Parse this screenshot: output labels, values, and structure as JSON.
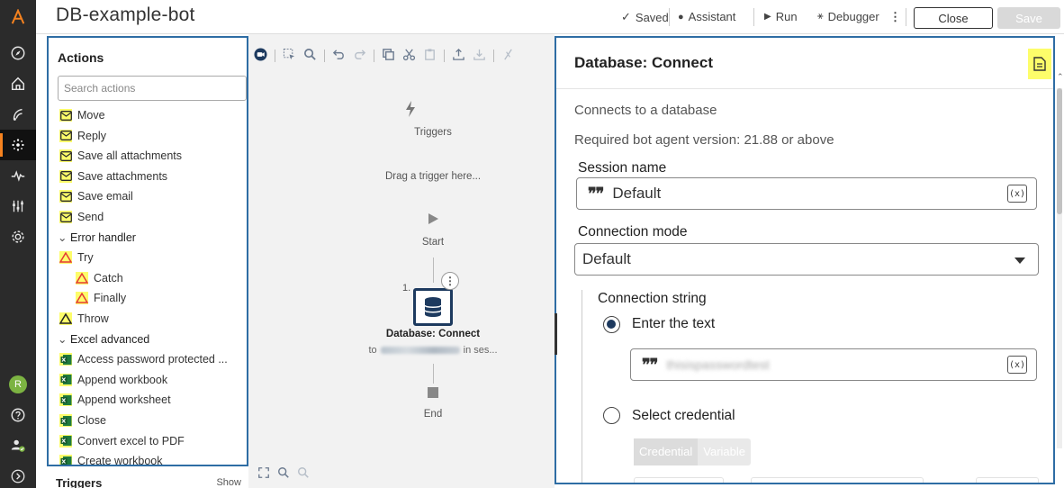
{
  "rail": {
    "icons": [
      "automation-logo-icon",
      "compass-icon",
      "home-icon",
      "bot-icon",
      "automations-icon",
      "pulse-icon",
      "sliders-icon",
      "settings-icon",
      "user-avatar",
      "help-icon",
      "user-check-icon",
      "chevron-right-icon"
    ],
    "avatar_initial": "R"
  },
  "topbar": {
    "title": "DB-example-bot",
    "saved_label": "Saved",
    "assistant_label": "Assistant",
    "run_label": "Run",
    "debugger_label": "Debugger",
    "close_label": "Close",
    "save_label": "Save"
  },
  "actions": {
    "title": "Actions",
    "search_placeholder": "Search actions",
    "email_items": [
      "Move",
      "Reply",
      "Save all attachments",
      "Save attachments",
      "Save email",
      "Send"
    ],
    "error_group": "Error handler",
    "error_items": [
      "Try",
      "Catch",
      "Finally",
      "Throw"
    ],
    "excel_group": "Excel advanced",
    "excel_items": [
      "Access password protected ...",
      "Append workbook",
      "Append worksheet",
      "Close",
      "Convert excel to PDF",
      "Create workbook"
    ],
    "triggers_footer": "Triggers",
    "triggers_show": "Show"
  },
  "canvas": {
    "triggers_label": "Triggers",
    "drag_hint": "Drag a trigger here...",
    "start_label": "Start",
    "node_number": "1.",
    "node_title": "Database: Connect",
    "node_sub_prefix": "to",
    "node_sub_suffix": "in ses...",
    "end_label": "End"
  },
  "props": {
    "title": "Database: Connect",
    "description": "Connects to a database",
    "version_req": "Required bot agent version: 21.88 or above",
    "session_label": "Session name",
    "session_value": "Default",
    "mode_label": "Connection mode",
    "mode_value": "Default",
    "conn_string_label": "Connection string",
    "enter_text_label": "Enter the text",
    "conn_string_value": "thisispasswordtest",
    "select_cred_label": "Select credential",
    "tab_credential": "Credential",
    "tab_variable": "Variable",
    "var_button": "(x)"
  },
  "colors": {
    "highlight": "#fdfd6a",
    "panel_border": "#2e6da4",
    "node_border": "#1d3a5f",
    "email_icon": "#2b2b2b",
    "error_icon": "#e53935",
    "excel_icon": "#1f7a3e"
  }
}
